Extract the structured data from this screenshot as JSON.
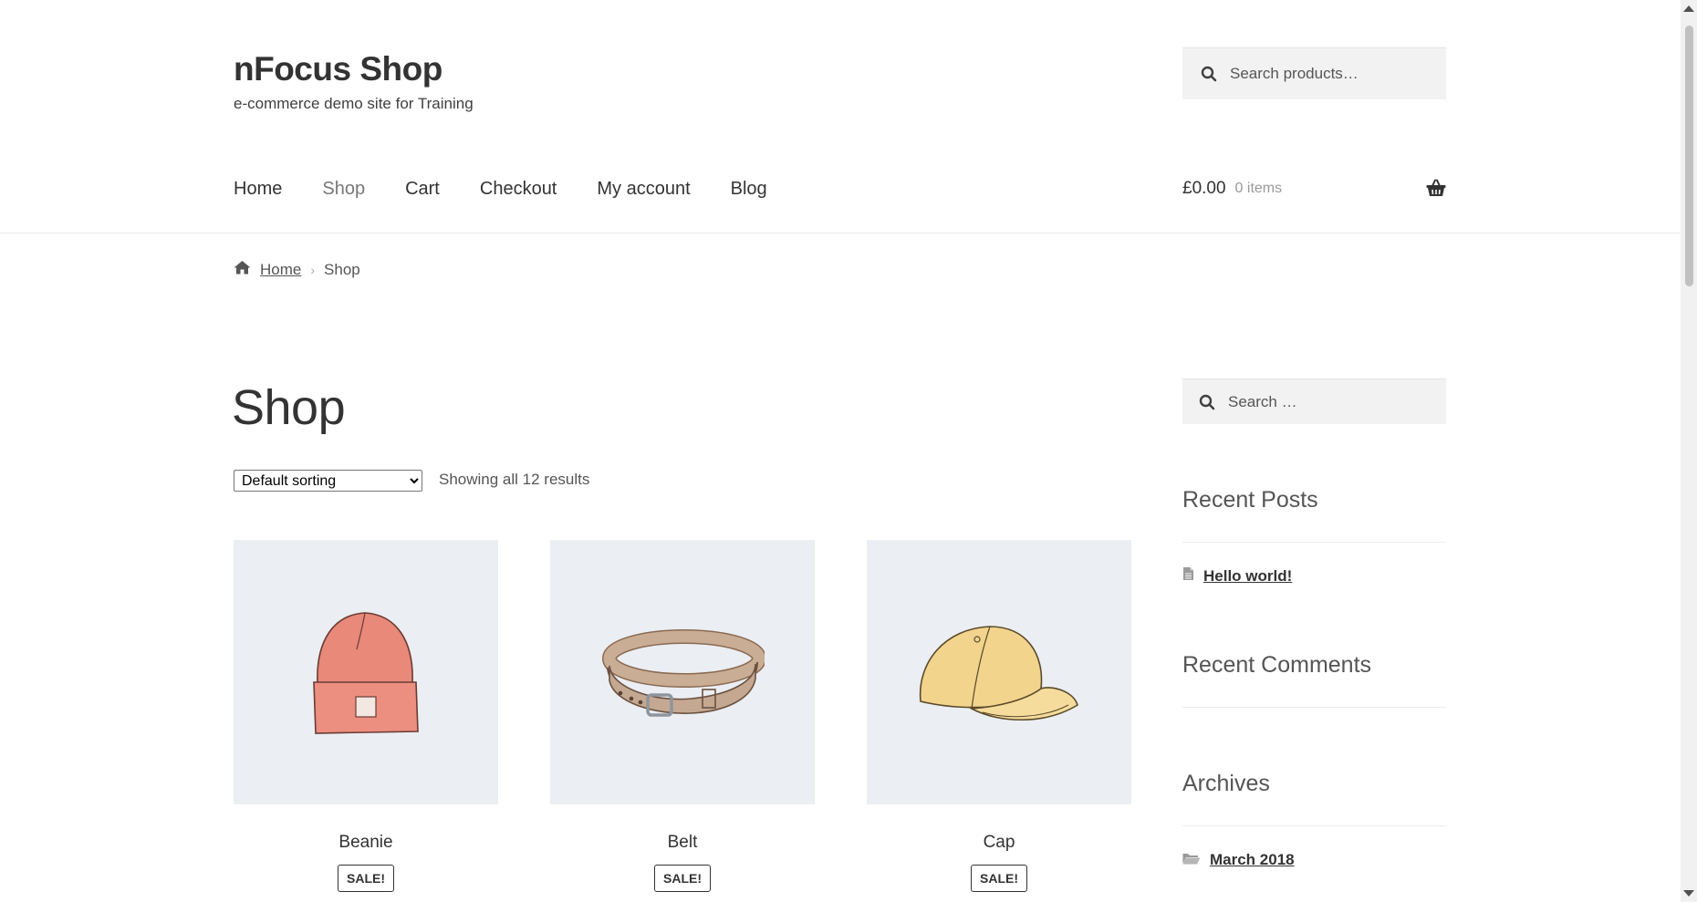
{
  "site": {
    "title": "nFocus Shop",
    "description": "e-commerce demo site for Training"
  },
  "header_search": {
    "placeholder": "Search products…",
    "icon": "search-icon"
  },
  "nav": [
    {
      "label": "Home",
      "current": false
    },
    {
      "label": "Shop",
      "current": true
    },
    {
      "label": "Cart",
      "current": false
    },
    {
      "label": "Checkout",
      "current": false
    },
    {
      "label": "My account",
      "current": false
    },
    {
      "label": "Blog",
      "current": false
    }
  ],
  "cart": {
    "total": "£0.00",
    "count": "0 items",
    "icon": "basket-icon"
  },
  "breadcrumb": {
    "home": "Home",
    "separator": "›",
    "current": "Shop"
  },
  "page": {
    "title": "Shop"
  },
  "sorting": {
    "selected": "Default sorting"
  },
  "results": {
    "text": "Showing all 12 results"
  },
  "products": [
    {
      "name": "Beanie",
      "badge": "SALE!",
      "image": "beanie"
    },
    {
      "name": "Belt",
      "badge": "SALE!",
      "image": "belt"
    },
    {
      "name": "Cap",
      "badge": "SALE!",
      "image": "cap"
    }
  ],
  "sidebar": {
    "search_placeholder": "Search …",
    "recent_posts": {
      "title": "Recent Posts",
      "items": [
        "Hello world!"
      ]
    },
    "recent_comments": {
      "title": "Recent Comments"
    },
    "archives": {
      "title": "Archives",
      "items": [
        "March 2018"
      ]
    }
  },
  "colors": {
    "accent": "#333333",
    "muted_link": "#777777",
    "thumb_bg": "#ebeef2",
    "search_bg": "#f2f2f2"
  }
}
